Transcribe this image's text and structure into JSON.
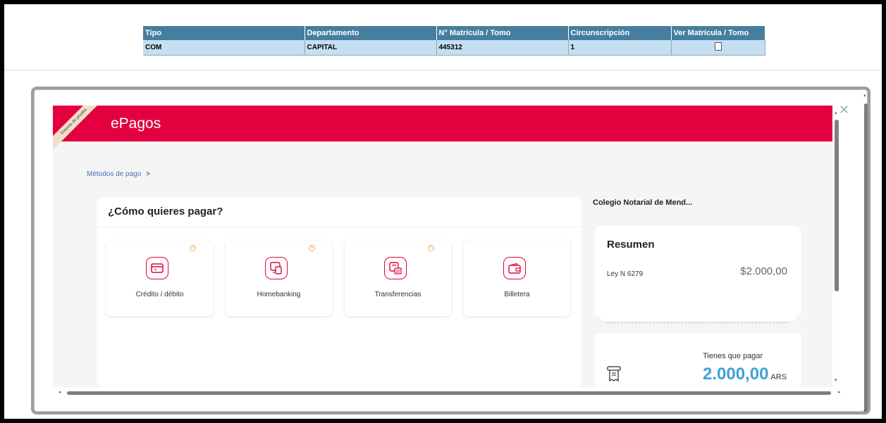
{
  "table": {
    "headers": [
      "Tipo",
      "Departamento",
      "N° Matrícula / Tomo",
      "Circunscripción",
      "Ver Matrícula / Tomo"
    ],
    "row": [
      "COM",
      "CAPITAL",
      "445312",
      "1"
    ]
  },
  "epagos": {
    "brand": "ePagos",
    "ribbon": "Entorno de prueba",
    "breadcrumb": "Métodos de pago",
    "breadcrumb_sep": ">",
    "question": "¿Cómo quieres pagar?",
    "methods": [
      {
        "label": "Crédito / débito",
        "icon": "credit-card-icon",
        "tag": true
      },
      {
        "label": "Homebanking",
        "icon": "homebanking-icon",
        "tag": true
      },
      {
        "label": "Transferencias",
        "icon": "bank-transfer-icon",
        "tag": true
      },
      {
        "label": "Billetera",
        "icon": "wallet-icon",
        "tag": false
      }
    ],
    "merchant": "Colegio Notarial de Mend...",
    "summary": {
      "title": "Resumen",
      "item": "Ley N 6279",
      "amount": "$2.000,00"
    },
    "pay": {
      "label": "Tienes que pagar",
      "amount": "2.000,00",
      "currency": "ARS"
    }
  },
  "colors": {
    "brand": "#e3003e",
    "table_header": "#457e9f",
    "table_row": "#c4dff1",
    "amount": "#3ea2d8"
  }
}
